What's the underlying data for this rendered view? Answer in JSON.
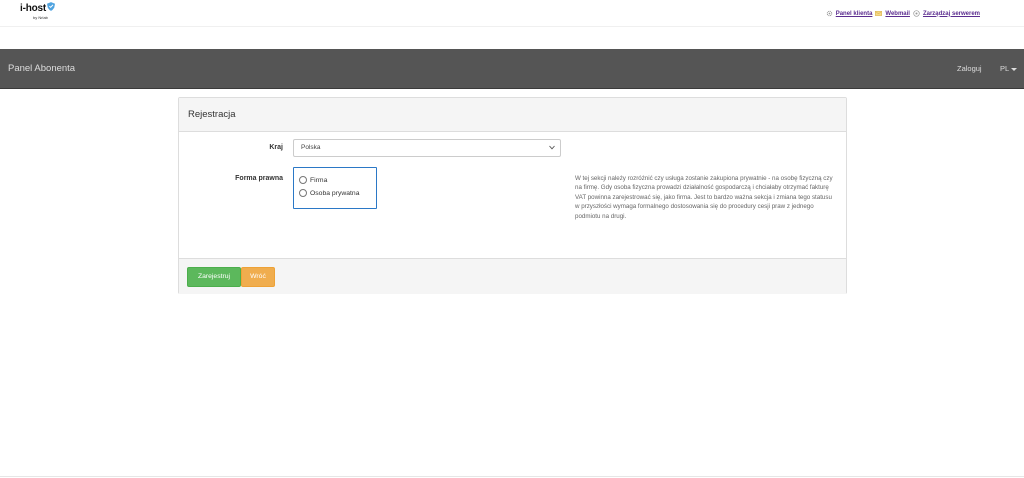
{
  "logo": {
    "name": "i-host",
    "tagline": "by Nrlab"
  },
  "top_links": [
    {
      "label": "Panel klienta",
      "icon": "gear-icon"
    },
    {
      "label": "Webmail",
      "icon": "envelope-icon"
    },
    {
      "label": "Zarządzaj serwerem",
      "icon": "server-icon"
    }
  ],
  "navbar": {
    "brand": "Panel Abonenta",
    "login": "Zaloguj",
    "language": "PL"
  },
  "form": {
    "title": "Rejestracja",
    "country_label": "Kraj",
    "country_value": "Polska",
    "legal_form_label": "Forma prawna",
    "options": [
      "Firma",
      "Osoba prywatna"
    ],
    "help": "W tej sekcji należy rozróżnić czy usługa zostanie zakupiona prywatnie - na osobę fizyczną czy na firmę. Gdy osoba fizyczna prowadzi działalność gospodarczą i chciałaby otrzymać fakturę VAT powinna zarejestrować się, jako firma. Jest to bardzo ważna sekcja i zmiana tego statusu w przyszłości wymaga formalnego dostosowania się do procedury cesji praw z jednego podmiotu na drugi.",
    "register_button": "Zarejestruj",
    "back_button": "Wróć"
  },
  "colors": {
    "navbar": "#555555",
    "register": "#5cb85c",
    "back": "#f0ad4e",
    "focus": "#2b78c6",
    "link": "#5b2c8f"
  }
}
